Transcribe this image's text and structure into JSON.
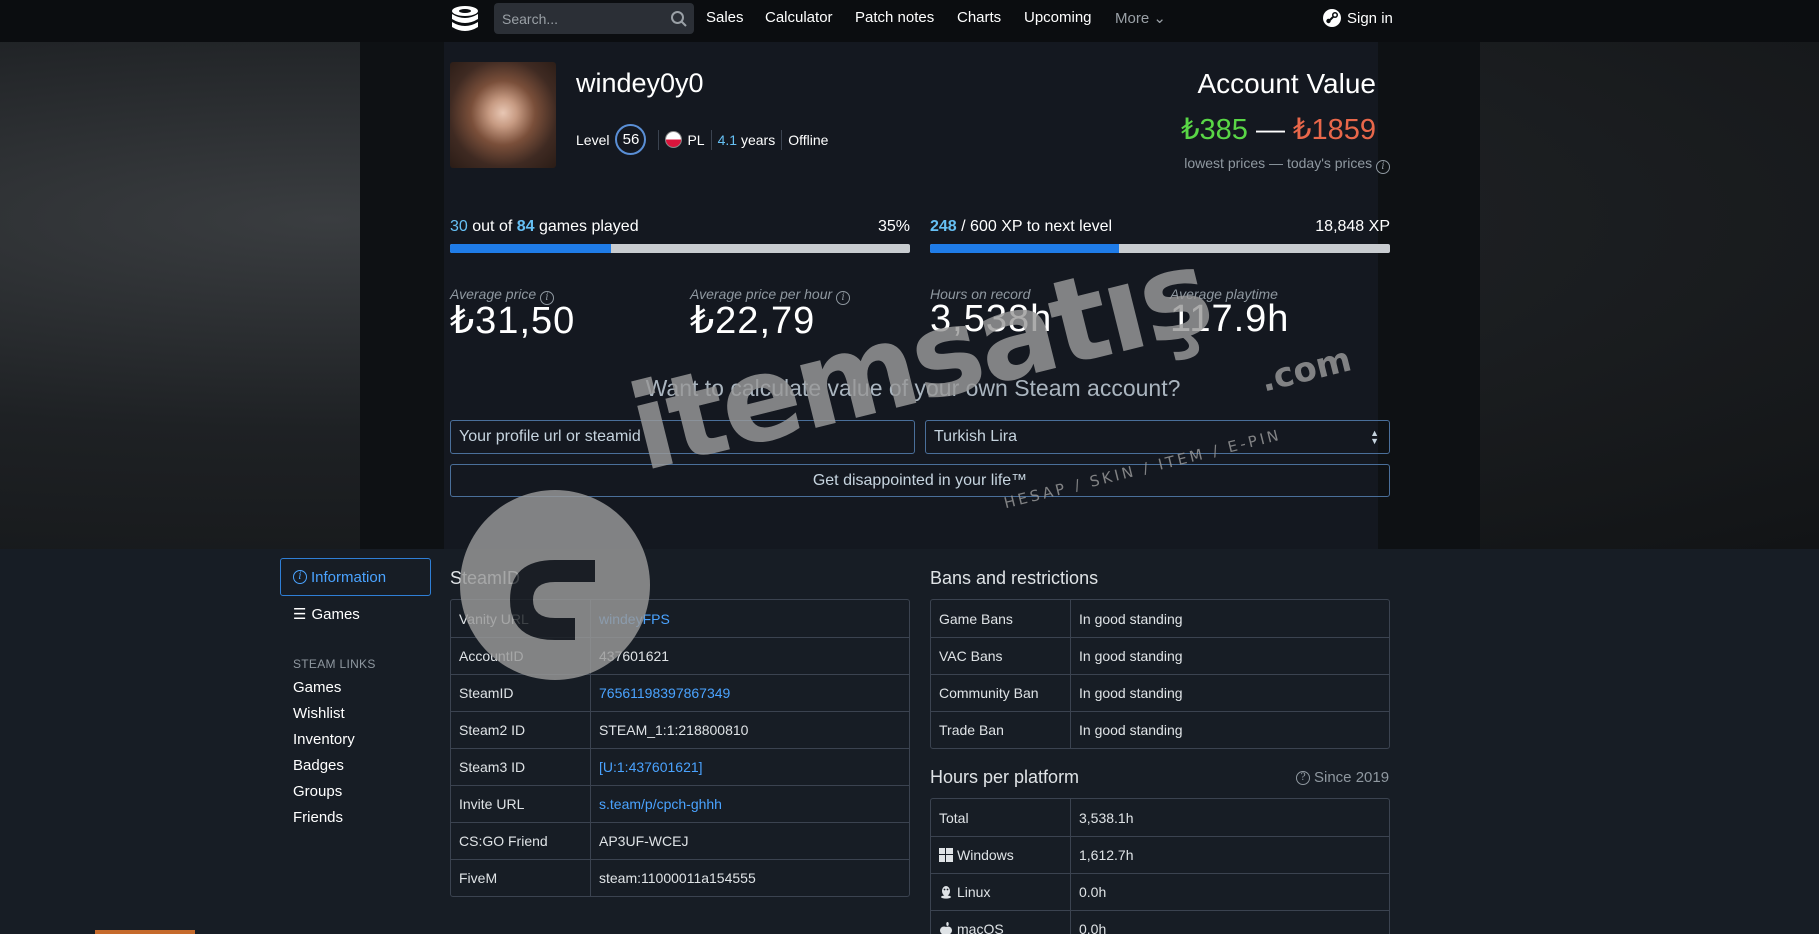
{
  "nav": {
    "search_placeholder": "Search...",
    "links": [
      "Sales",
      "Calculator",
      "Patch notes",
      "Charts",
      "Upcoming",
      "More"
    ],
    "signin": "Sign in"
  },
  "profile": {
    "username": "windey0y0",
    "level_label": "Level",
    "level": "56",
    "country": "PL",
    "years_value": "4.1",
    "years_label": "years",
    "status": "Offline"
  },
  "account_value": {
    "title": "Account Value",
    "low": "₺385",
    "dash": "—",
    "high": "₺1859",
    "note": "lowest prices — today's prices"
  },
  "games_progress": {
    "played": "30",
    "label_mid": "out of",
    "total": "84",
    "label_end": "games played",
    "percent": "35%",
    "fill_fraction": 0.35
  },
  "xp_progress": {
    "current": "248",
    "label": "/ 600 XP to next level",
    "total_xp": "18,848 XP",
    "fill_fraction": 0.41
  },
  "stats": [
    {
      "label": "Average price",
      "value": "₺31,50"
    },
    {
      "label": "Average price per hour",
      "value": "₺22,79"
    },
    {
      "label": "Hours on record",
      "value": "3,538h"
    },
    {
      "label": "Average playtime",
      "value": "117.9h"
    }
  ],
  "calculator": {
    "title": "Want to calculate value of your own Steam account?",
    "input_placeholder": "Your profile url or steamid",
    "currency": "Turkish Lira",
    "button": "Get disappointed in your life™"
  },
  "sidebar": {
    "information": "Information",
    "games": "Games",
    "steam_links_heading": "STEAM LINKS",
    "links": [
      "Games",
      "Wishlist",
      "Inventory",
      "Badges",
      "Groups",
      "Friends"
    ]
  },
  "steamid": {
    "title": "SteamID",
    "rows": [
      {
        "key": "Vanity URL",
        "value": "windeyFPS",
        "link": true
      },
      {
        "key": "AccountID",
        "value": "437601621",
        "link": false
      },
      {
        "key": "SteamID",
        "value": "76561198397867349",
        "link": true
      },
      {
        "key": "Steam2 ID",
        "value": "STEAM_1:1:218800810",
        "link": false
      },
      {
        "key": "Steam3 ID",
        "value": "[U:1:437601621]",
        "link": true
      },
      {
        "key": "Invite URL",
        "value": "s.team/p/cpch-ghhh",
        "link": true
      },
      {
        "key": "CS:GO Friend",
        "value": "AP3UF-WCEJ",
        "link": false
      },
      {
        "key": "FiveM",
        "value": "steam:11000011a154555",
        "link": false
      }
    ]
  },
  "bans": {
    "title": "Bans and restrictions",
    "rows": [
      {
        "key": "Game Bans",
        "value": "In good standing"
      },
      {
        "key": "VAC Bans",
        "value": "In good standing"
      },
      {
        "key": "Community Ban",
        "value": "In good standing"
      },
      {
        "key": "Trade Ban",
        "value": "In good standing"
      }
    ]
  },
  "hours_platform": {
    "title": "Hours per platform",
    "since": "Since 2019",
    "rows": [
      {
        "key": "Total",
        "value": "3,538.1h",
        "icon": ""
      },
      {
        "key": "Windows",
        "value": "1,612.7h",
        "icon": "windows-icon"
      },
      {
        "key": "Linux",
        "value": "0.0h",
        "icon": "linux-icon"
      },
      {
        "key": "macOS",
        "value": "0.0h",
        "icon": "apple-icon"
      }
    ]
  },
  "watermark": {
    "brand": "itemsatış",
    "tld": ".com",
    "tagline": "HESAP / SKIN / ITEM / E-PIN"
  },
  "colors": {
    "accent_blue": "#66c0f4",
    "low_green": "#59d646",
    "high_red": "#e8674a",
    "bar_fill": "#1f7ce8"
  }
}
